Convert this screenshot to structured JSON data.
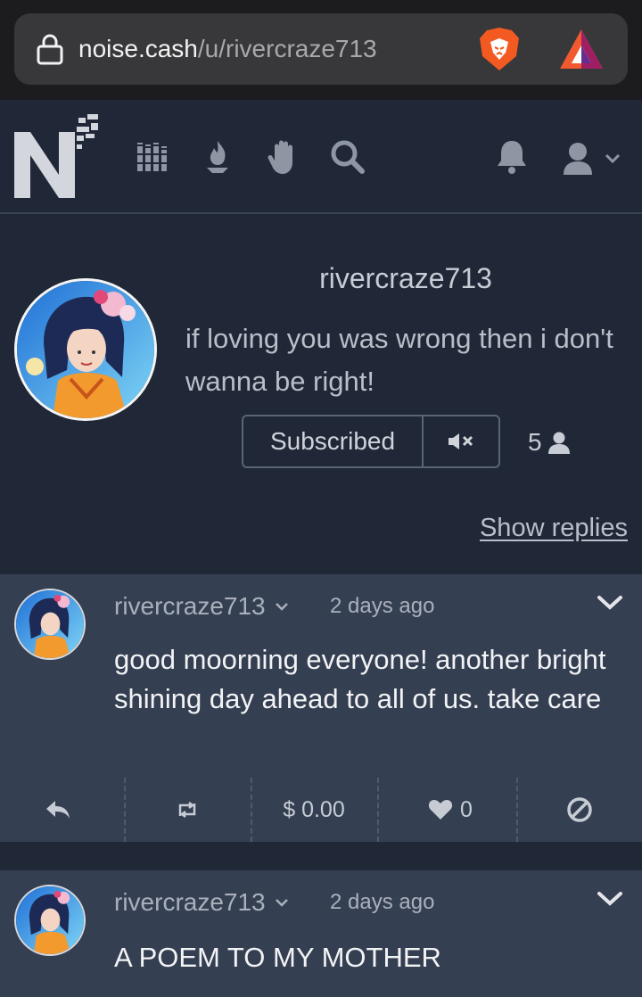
{
  "browser": {
    "url_domain": "noise.cash",
    "url_path": "/u/rivercraze713"
  },
  "nav": {
    "icons": [
      "logo-icon",
      "library-icon",
      "fire-icon",
      "hand-icon",
      "search-icon",
      "bell-icon",
      "user-icon",
      "chevron-down-icon"
    ]
  },
  "profile": {
    "username": "rivercraze713",
    "bio": "if loving you was wrong then i don't wanna be right!",
    "subscribe_label": "Subscribed",
    "subscriber_count": "5",
    "show_replies": "Show replies"
  },
  "posts": [
    {
      "author": "rivercraze713",
      "time": "2 days ago",
      "text": "good moorning everyone! another bright shining day ahead to all of us. take care",
      "tip_amount": "$ 0.00",
      "likes": "0"
    },
    {
      "author": "rivercraze713",
      "time": "2 days ago",
      "text": "A POEM TO MY MOTHER"
    }
  ],
  "colors": {
    "background": "#202838",
    "post_background": "#353f52",
    "browser_bar": "#1c1c1e"
  }
}
